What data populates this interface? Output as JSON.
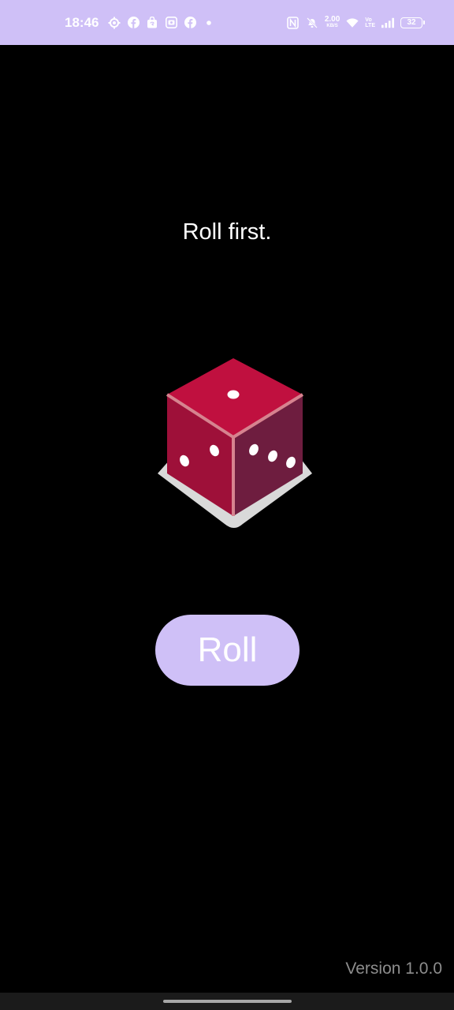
{
  "status_bar": {
    "time": "18:46",
    "notification_icons": [
      "gear-icon",
      "facebook-icon",
      "shopping-bag-icon",
      "photo-app-icon",
      "facebook-icon",
      "dot-icon"
    ],
    "network_speed_value": "2.00",
    "network_speed_unit": "KB/S",
    "volte_top": "Vo",
    "volte_bottom": "LTE",
    "battery": "32"
  },
  "main": {
    "status_message": "Roll first.",
    "dice": {
      "top_face_pips": 1,
      "left_face_pips": 2,
      "right_face_pips": 3,
      "colors": {
        "top": "#c0103f",
        "left": "#9e1039",
        "right": "#6e1d3f",
        "edge": "#d6838f",
        "shadow": "#d9d9d9"
      }
    },
    "roll_button_label": "Roll"
  },
  "footer": {
    "version": "Version 1.0.0"
  },
  "colors": {
    "accent": "#cfc0f7",
    "background": "#000000",
    "version_text": "#8d8d8d"
  }
}
